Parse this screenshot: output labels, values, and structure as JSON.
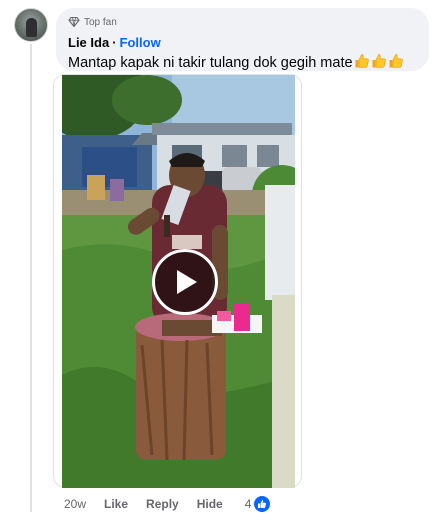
{
  "comment": {
    "badge": "Top fan",
    "author": "Lie Ida",
    "separator": "·",
    "follow_label": "Follow",
    "text": "Mantap kapak ni takir tulang dok gegih mate",
    "emoji_icon": "thumbs-up-emoji",
    "emoji_count": 3
  },
  "video": {
    "play_icon": "play-icon"
  },
  "actions": {
    "time": "20w",
    "like_label": "Like",
    "reply_label": "Reply",
    "hide_label": "Hide",
    "reaction_count": "4",
    "reaction_icon": "like-reaction-icon"
  },
  "colors": {
    "bubble": "#f0f2f5",
    "link": "#0866ff",
    "meta": "#65676b",
    "text": "#050505"
  }
}
